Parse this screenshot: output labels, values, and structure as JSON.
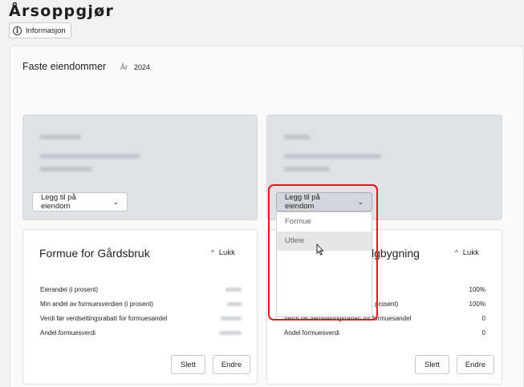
{
  "header": {
    "title": "Årsoppgjør",
    "info_button": "Informasjon",
    "info_icon": "info-circle-icon"
  },
  "section": {
    "title": "Faste eiendommer",
    "year_label": "År",
    "year_value": "2024"
  },
  "property_cards": [
    {
      "add_button": "Legg til på eiendom"
    },
    {
      "add_button": "Legg til på eiendom"
    }
  ],
  "dropdown": {
    "items": [
      "Formue",
      "Utleie"
    ],
    "hovered": "Utleie"
  },
  "colors": {
    "highlight": "#e0181f",
    "card_bg": "#dfe1e4"
  },
  "asset_cards": [
    {
      "title": "Formue for Gårdsbruk",
      "close_label": "Lukk",
      "rows": [
        {
          "label": "Eierandel (i prosent)"
        },
        {
          "label": "Min andel av formuesverdien (i prosent)"
        },
        {
          "label": "Verdi før verdsettingsrabatt for formuesandel"
        },
        {
          "label": "Andel formuesverdi"
        }
      ],
      "delete_label": "Slett",
      "edit_label": "Endre"
    },
    {
      "title_visible_suffix": "lgbygning",
      "close_label": "Lukk",
      "rows": [
        {
          "label_visible": "",
          "value": "100%"
        },
        {
          "label_visible": "prosent)",
          "value": "100%"
        },
        {
          "label_visible": "Verdi før verdsettingsrabatt for formuesandel",
          "value": "0"
        },
        {
          "label_visible": "Andel formuesverdi",
          "value": "0"
        }
      ],
      "delete_label": "Slett",
      "edit_label": "Endre"
    }
  ]
}
